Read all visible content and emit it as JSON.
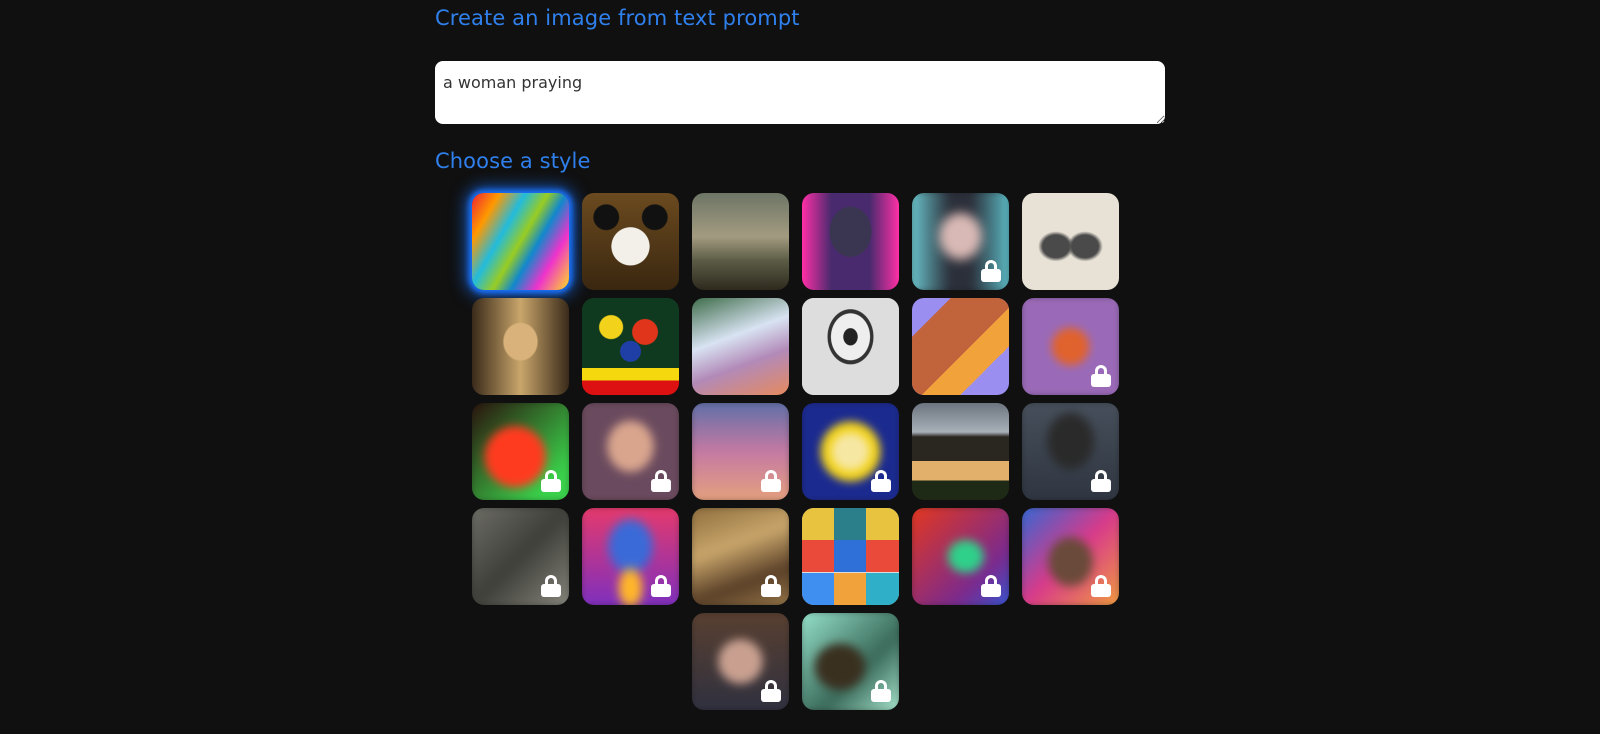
{
  "headings": {
    "create": "Create an image from text prompt",
    "style": "Choose a style"
  },
  "prompt": {
    "value": "a woman praying"
  },
  "styles": [
    {
      "icon": "abstract-paint-thumbnail",
      "locked": false,
      "selected": true
    },
    {
      "icon": "panda-thumbnail",
      "locked": false,
      "selected": false
    },
    {
      "icon": "landscape-painting-thumbnail",
      "locked": false,
      "selected": false
    },
    {
      "icon": "neon-robot-thumbnail",
      "locked": false,
      "selected": false
    },
    {
      "icon": "anime-woman-thumbnail",
      "locked": true,
      "selected": false
    },
    {
      "icon": "engraving-gentlemen-thumbnail",
      "locked": false,
      "selected": false
    },
    {
      "icon": "renaissance-portrait-thumbnail",
      "locked": false,
      "selected": false
    },
    {
      "icon": "flower-vase-thumbnail",
      "locked": false,
      "selected": false
    },
    {
      "icon": "ballet-dancers-thumbnail",
      "locked": false,
      "selected": false
    },
    {
      "icon": "sketch-cup-thumbnail",
      "locked": false,
      "selected": false
    },
    {
      "icon": "isometric-room-thumbnail",
      "locked": false,
      "selected": false
    },
    {
      "icon": "fox-thumbnail",
      "locked": true,
      "selected": false
    },
    {
      "icon": "neon-face-thumbnail",
      "locked": true,
      "selected": false
    },
    {
      "icon": "woman-portrait-thumbnail",
      "locked": true,
      "selected": false
    },
    {
      "icon": "rainbow-sky-thumbnail",
      "locked": true,
      "selected": false
    },
    {
      "icon": "pop-art-thumbnail",
      "locked": true,
      "selected": false
    },
    {
      "icon": "modern-house-thumbnail",
      "locked": false,
      "selected": false
    },
    {
      "icon": "dark-rock-thumbnail",
      "locked": true,
      "selected": false
    },
    {
      "icon": "interior-thumbnail",
      "locked": true,
      "selected": false
    },
    {
      "icon": "rabbit-thumbnail",
      "locked": true,
      "selected": false
    },
    {
      "icon": "old-painting-thumbnail",
      "locked": true,
      "selected": false
    },
    {
      "icon": "icon-grid-thumbnail",
      "locked": false,
      "selected": false
    },
    {
      "icon": "dragon-thumbnail",
      "locked": true,
      "selected": false
    },
    {
      "icon": "colorful-face-thumbnail",
      "locked": true,
      "selected": false
    },
    {
      "icon": "fantasy-woman-thumbnail",
      "locked": true,
      "selected": false
    },
    {
      "icon": "teal-tree-thumbnail",
      "locked": true,
      "selected": false
    }
  ]
}
